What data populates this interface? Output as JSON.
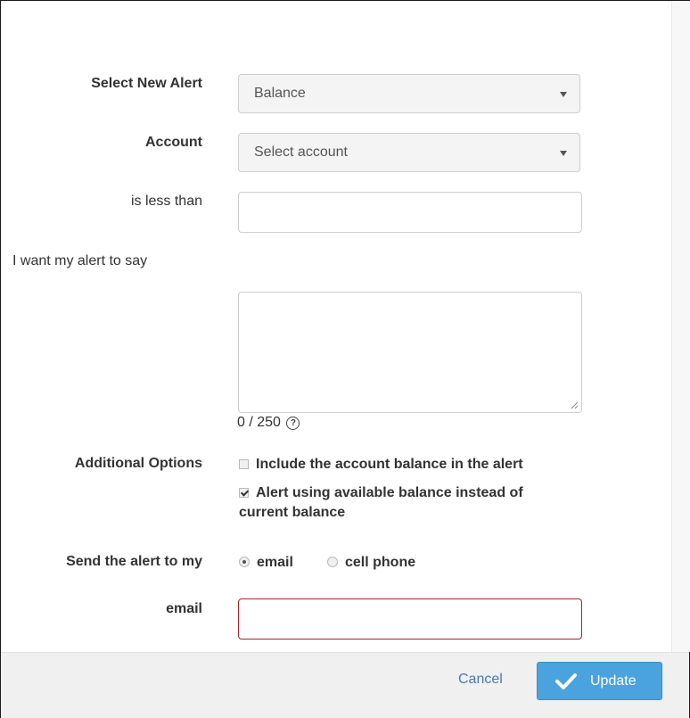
{
  "form": {
    "select_new_alert": {
      "label": "Select New Alert",
      "value": "Balance"
    },
    "account": {
      "label": "Account",
      "value": "Select account"
    },
    "threshold": {
      "label": "is less than",
      "value": ""
    },
    "message": {
      "label": "I want my alert to say",
      "value": "",
      "counter": "0 / 250"
    },
    "additional_options": {
      "label": "Additional Options",
      "options": [
        {
          "label": "Include the account balance in the alert",
          "checked": false
        },
        {
          "label_line1": "Alert using available balance instead of",
          "label_line2": "current balance",
          "checked": true
        }
      ]
    },
    "send_to": {
      "label": "Send the alert to my",
      "options": [
        {
          "label": "email",
          "selected": true
        },
        {
          "label": "cell phone",
          "selected": false
        }
      ]
    },
    "email": {
      "label": "email",
      "value": "",
      "state": "error"
    }
  },
  "footer": {
    "cancel_label": "Cancel",
    "update_label": "Update"
  },
  "colors": {
    "primary_button": "#4aa3df",
    "link": "#4a79b4",
    "error_border": "#a8252b"
  },
  "icons": {
    "select_caret": "caret-down-icon",
    "help": "question-circle-icon",
    "update": "check-icon",
    "resize": "resize-grip-icon"
  }
}
